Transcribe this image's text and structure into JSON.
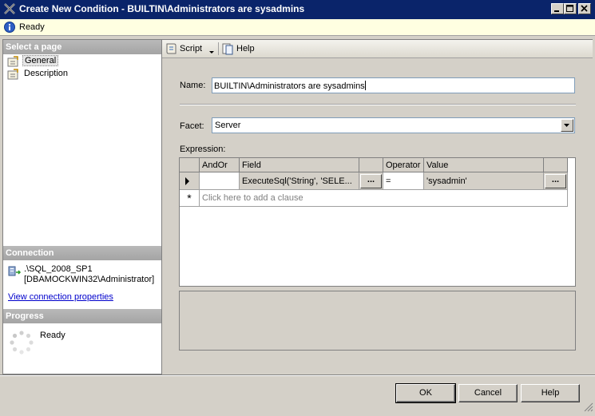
{
  "window": {
    "title": "Create New Condition - BUILTIN\\Administrators are sysadmins"
  },
  "status": {
    "text": "Ready",
    "icon": "info-icon"
  },
  "left": {
    "select_page_header": "Select a page",
    "pages": [
      {
        "label": "General",
        "selected": true
      },
      {
        "label": "Description",
        "selected": false
      }
    ],
    "connection_header": "Connection",
    "connection_server": ".\\SQL_2008_SP1",
    "connection_user": "[DBAMOCKWIN32\\Administrator]",
    "connection_link": "View connection properties",
    "progress_header": "Progress",
    "progress_status": "Ready"
  },
  "toolbar": {
    "script_label": "Script",
    "help_label": "Help"
  },
  "form": {
    "name_label": "Name:",
    "name_value": "BUILTIN\\Administrators are sysadmins",
    "facet_label": "Facet:",
    "facet_value": "Server",
    "expression_label": "Expression:"
  },
  "grid": {
    "headers": [
      "AndOr",
      "Field",
      "Operator",
      "Value"
    ],
    "row": {
      "andor": "",
      "field": "ExecuteSql('String', 'SELE...",
      "operator": "=",
      "value": "'sysadmin'"
    },
    "ellipsis": "...",
    "add_row_marker": "*",
    "add_clause": "Click here to add a clause"
  },
  "buttons": {
    "ok": "OK",
    "cancel": "Cancel",
    "help": "Help"
  },
  "colors": {
    "titlebar": "#0a246a",
    "link": "#0000cc",
    "status_background": "#ffffe1"
  }
}
